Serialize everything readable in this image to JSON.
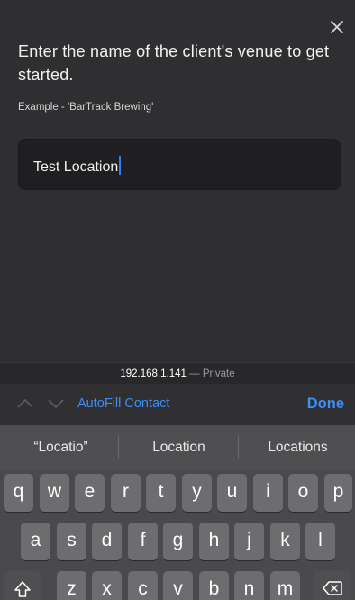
{
  "app": {
    "close_icon": "close-icon",
    "heading": "Enter the name of the client's venue to get started.",
    "example": "Example - 'BarTrack Brewing'",
    "input_value": "Test Location"
  },
  "address_bar": {
    "ip": "192.168.1.141",
    "separator": " — ",
    "private_label": "Private"
  },
  "accessory_bar": {
    "autofill_label": "AutoFill Contact",
    "done_label": "Done",
    "accent": "#3d8ef5"
  },
  "keyboard": {
    "suggestions": [
      "“Locatio”",
      "Location",
      "Locations"
    ],
    "row1": [
      "q",
      "w",
      "e",
      "r",
      "t",
      "y",
      "u",
      "i",
      "o",
      "p"
    ],
    "row2": [
      "a",
      "s",
      "d",
      "f",
      "g",
      "h",
      "j",
      "k",
      "l"
    ],
    "row3": [
      "z",
      "x",
      "c",
      "v",
      "b",
      "n",
      "m"
    ],
    "shift_icon": "shift-icon",
    "backspace_icon": "backspace-icon"
  }
}
